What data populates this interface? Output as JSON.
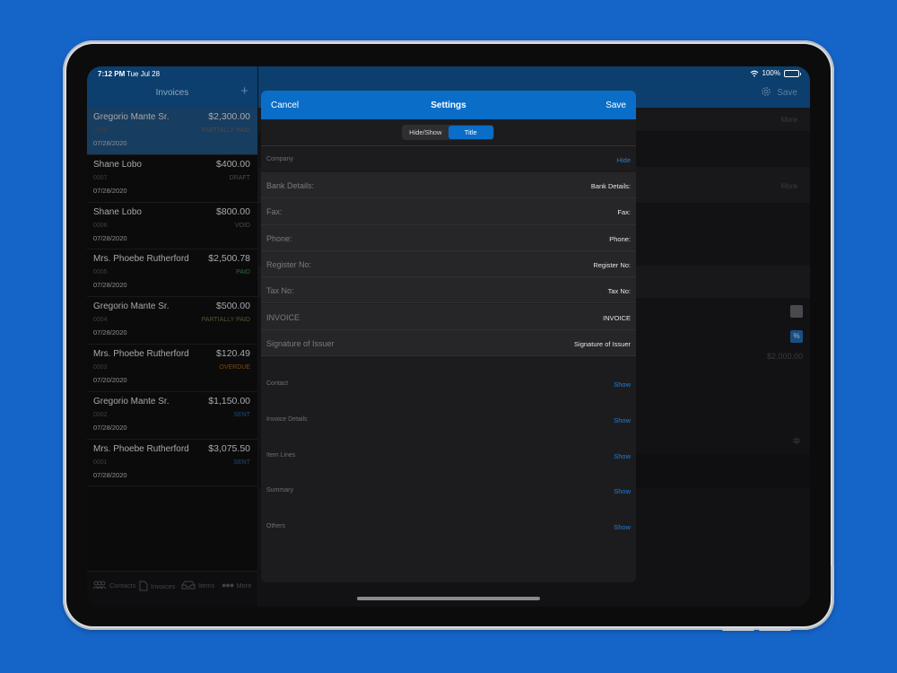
{
  "status_bar": {
    "time": "7:12 PM",
    "date": "Tue Jul 28",
    "battery": "100%",
    "battery_level": 1.0
  },
  "sidebar": {
    "title": "Invoices",
    "add_icon": "plus-icon",
    "invoices": [
      {
        "name": "Gregorio Mante Sr.",
        "amount": "$2,300.00",
        "number": "0008",
        "status": "PARTIALLY PAID",
        "date": "07/28/2020",
        "status_color": "#4a4a50"
      },
      {
        "name": "Shane Lobo",
        "amount": "$400.00",
        "number": "0007",
        "status": "DRAFT",
        "date": "07/28/2020",
        "status_color": "#4a4a50"
      },
      {
        "name": "Shane Lobo",
        "amount": "$800.00",
        "number": "0006",
        "status": "VOID",
        "date": "07/28/2020",
        "status_color": "#4a4a50"
      },
      {
        "name": "Mrs. Phoebe Rutherford",
        "amount": "$2,500.78",
        "number": "0005",
        "status": "PAID",
        "date": "07/28/2020",
        "status_color": "#2f6b34"
      },
      {
        "name": "Gregorio Mante Sr.",
        "amount": "$500.00",
        "number": "0004",
        "status": "PARTIALLY PAID",
        "date": "07/28/2020",
        "status_color": "#4c5a2f"
      },
      {
        "name": "Mrs. Phoebe Rutherford",
        "amount": "$120.49",
        "number": "0003",
        "status": "OVERDUE",
        "date": "07/20/2020",
        "status_color": "#7a4a12"
      },
      {
        "name": "Gregorio Mante Sr.",
        "amount": "$1,150.00",
        "number": "0002",
        "status": "SENT",
        "date": "07/28/2020",
        "status_color": "#1f4a73"
      },
      {
        "name": "Mrs. Phoebe Rutherford",
        "amount": "$3,075.50",
        "number": "0001",
        "status": "SENT",
        "date": "07/28/2020",
        "status_color": "#1f4a73"
      }
    ],
    "tabs": [
      {
        "label": "Contacts",
        "icon": "contacts-icon"
      },
      {
        "label": "Invoices",
        "icon": "document-icon"
      },
      {
        "label": "Items",
        "icon": "tray-icon"
      },
      {
        "label": "More",
        "icon": "ellipsis-icon"
      }
    ]
  },
  "detail": {
    "save_label": "Save",
    "gear_icon": "gear-icon",
    "more_1": "More",
    "more_2": "More",
    "amount": "$2,000.00",
    "percent_label": "%"
  },
  "modal": {
    "cancel_label": "Cancel",
    "title": "Settings",
    "save_label": "Save",
    "segments": [
      {
        "label": "Hide/Show",
        "selected": false
      },
      {
        "label": "Title",
        "selected": true
      }
    ],
    "company_section": {
      "label": "Company",
      "action": "Hide"
    },
    "fields": [
      {
        "label": "Bank Details:",
        "value": "Bank Details:"
      },
      {
        "label": "Fax:",
        "value": "Fax:"
      },
      {
        "label": "Phone:",
        "value": "Phone:"
      },
      {
        "label": "Register No:",
        "value": "Register No:"
      },
      {
        "label": "Tax No:",
        "value": "Tax No:"
      },
      {
        "label": "INVOICE",
        "value": "INVOICE"
      },
      {
        "label": "Signature of Issuer",
        "value": "Signature of Issuer"
      }
    ],
    "other_sections": [
      {
        "label": "Contact",
        "action": "Show"
      },
      {
        "label": "Invoice Details",
        "action": "Show"
      },
      {
        "label": "Item Lines",
        "action": "Show"
      },
      {
        "label": "Summary",
        "action": "Show"
      },
      {
        "label": "Others",
        "action": "Show"
      }
    ]
  },
  "colors": {
    "background": "#1565c9",
    "accent": "#0a6ec8",
    "link": "#1f7fd6"
  }
}
